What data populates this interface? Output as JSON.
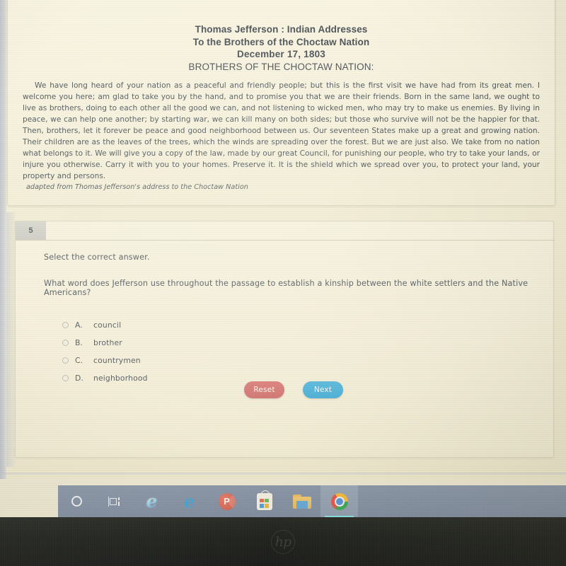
{
  "passage": {
    "title_line_1": "Thomas Jefferson : Indian Addresses",
    "title_line_2": "To the Brothers of the Choctaw Nation",
    "title_line_3": "December 17, 1803",
    "title_line_4": "BROTHERS OF THE CHOCTAW NATION:",
    "body": "We have long heard of your nation as a peaceful and friendly people; but this is the first visit we have had from its great men. I welcome you here; am glad to take you by the hand, and to promise you that we are their friends. Born in the same land, we ought to live as brothers, doing to each other all the good we can, and not listening to wicked men, who may try to make us enemies. By living in peace, we can help one another; by starting war, we can kill many on both sides; but those who survive will not be the happier for that. Then, brothers, let it forever be peace and good neighborhood between us. Our seventeen States make up a great and growing nation. Their children are as the leaves of the trees, which the winds are spreading over the forest. But we are just also. We take from no nation what belongs to it. We will give you a copy of the law, made by our great Council, for punishing our people, who try to take your lands, or injure you otherwise. Carry it with you to your homes. Preserve it. It is the shield which we spread over you, to protect your land, your property and persons.",
    "attribution": "adapted from Thomas Jefferson's address to the Choctaw Nation"
  },
  "question": {
    "number": "5",
    "instruction": "Select the correct answer.",
    "stem": "What word does Jefferson use throughout the passage to establish a kinship between the white settlers and the Native Americans?",
    "options": [
      {
        "letter": "A.",
        "text": "council",
        "selected": false
      },
      {
        "letter": "B.",
        "text": "brother",
        "selected": false
      },
      {
        "letter": "C.",
        "text": "countrymen",
        "selected": false
      },
      {
        "letter": "D.",
        "text": "neighborhood",
        "selected": false
      }
    ],
    "reset_label": "Reset",
    "next_label": "Next",
    "reset_color": "#cc6464",
    "next_color": "#34a7d6"
  },
  "taskbar": {
    "items": [
      {
        "name": "cortana",
        "label": "Cortana",
        "active": false
      },
      {
        "name": "task-view",
        "label": "Task View",
        "active": false
      },
      {
        "name": "internet-explorer",
        "label": "Internet Explorer",
        "glyph": "e",
        "active": false
      },
      {
        "name": "microsoft-edge",
        "label": "Microsoft Edge",
        "glyph": "e",
        "active": false
      },
      {
        "name": "powerpoint",
        "label": "PowerPoint",
        "glyph": "P",
        "active": false
      },
      {
        "name": "microsoft-store",
        "label": "Microsoft Store",
        "active": false
      },
      {
        "name": "file-explorer",
        "label": "File Explorer",
        "active": false
      },
      {
        "name": "google-chrome",
        "label": "Google Chrome",
        "active": true
      }
    ],
    "background_color": "#76849c"
  },
  "device": {
    "brand_mark": "hp"
  }
}
